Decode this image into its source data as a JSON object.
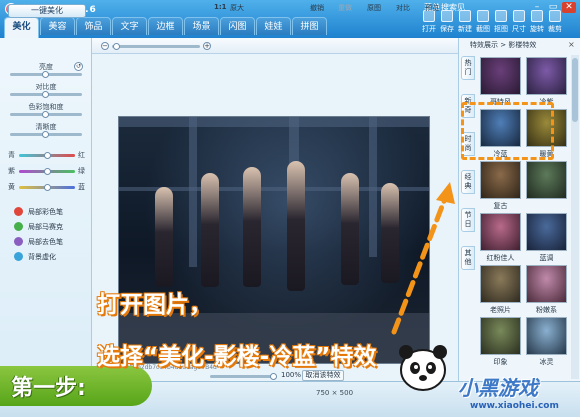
{
  "window": {
    "title": "美图秀秀 2.6.6",
    "menu": "菜单",
    "login": "搜索见",
    "min": "–",
    "max": "▭",
    "close": "✕"
  },
  "tabs": [
    "美化",
    "美容",
    "饰品",
    "文字",
    "边框",
    "场景",
    "闪图",
    "娃娃",
    "拼图"
  ],
  "active_tab": "美化",
  "toolbar": [
    "打开",
    "保存",
    "新建",
    "截图",
    "抠图",
    "尺寸",
    "旋转",
    "裁剪"
  ],
  "left_panel": {
    "one_click_button": "一键美化",
    "sliders": [
      "亮度",
      "对比度",
      "色彩饱和度",
      "清晰度"
    ],
    "color_balance": [
      {
        "left": "青",
        "right": "红"
      },
      {
        "left": "紫",
        "right": "绿"
      },
      {
        "left": "黄",
        "right": "蓝"
      }
    ],
    "tools": [
      {
        "label": "局部彩色笔",
        "color": "#e0463a"
      },
      {
        "label": "局部马赛克",
        "color": "#46b04a"
      },
      {
        "label": "局部去色笔",
        "color": "#8a5fc0"
      },
      {
        "label": "背景虚化",
        "color": "#3aa3d9"
      }
    ]
  },
  "canvas_toolbar": {
    "zoom_ratio": "1:1",
    "enlarge": "原大",
    "undo": "撤销",
    "redo": "重做",
    "original": "原图",
    "compare": "对比",
    "preview": "预览"
  },
  "canvas": {
    "filename": "37eb6b2db7c94b4d1u1ageVB4d",
    "zoom_percent": "100%",
    "cancel_effect": "取消该特效"
  },
  "status": {
    "size": "750 × 500",
    "ratio": ""
  },
  "effects_panel": {
    "header": "特效展示 > 影楼特效",
    "close": "×",
    "side_tabs": [
      "热门",
      "新奇",
      "时尚",
      "经典",
      "节日",
      "其他"
    ],
    "thumbnails": [
      {
        "label": "哥特风",
        "color_a": "#6a3f7a",
        "color_b": "#2a1a33"
      },
      {
        "label": "冷紫",
        "color_a": "#7d5aa8",
        "color_b": "#2b2140"
      },
      {
        "label": "冷蓝",
        "color_a": "#4f7fb8",
        "color_b": "#18283f"
      },
      {
        "label": "暖黄",
        "color_a": "#9a8a3a",
        "color_b": "#352f14"
      },
      {
        "label": "复古",
        "color_a": "#8a6a4a",
        "color_b": "#2f2418"
      },
      {
        "label": "",
        "color_a": "#5d7a5a",
        "color_b": "#1f2a1f"
      },
      {
        "label": "红粉佳人",
        "color_a": "#b86a8a",
        "color_b": "#3f1f2f"
      },
      {
        "label": "蓝调",
        "color_a": "#4a6a9a",
        "color_b": "#18223a"
      },
      {
        "label": "老照片",
        "color_a": "#8a7a5a",
        "color_b": "#2f2a1f"
      },
      {
        "label": "粉嫩系",
        "color_a": "#c08aaa",
        "color_b": "#4a2a3a"
      },
      {
        "label": "印象",
        "color_a": "#7a8a5a",
        "color_b": "#2a2f1f"
      },
      {
        "label": "冰灵",
        "color_a": "#8ab0d0",
        "color_b": "#26384a"
      }
    ]
  },
  "annotation": {
    "step": "第一步:",
    "line1": "打开图片，",
    "line2": "选择“美化-影楼-冷蓝”特效"
  },
  "watermark": {
    "logo": "小黑游戏",
    "url": "www.xiaohei.com"
  },
  "colors": {
    "titlebar": "#1f82cf",
    "accent_orange": "#f39419",
    "step_green": "#6bb52a"
  }
}
